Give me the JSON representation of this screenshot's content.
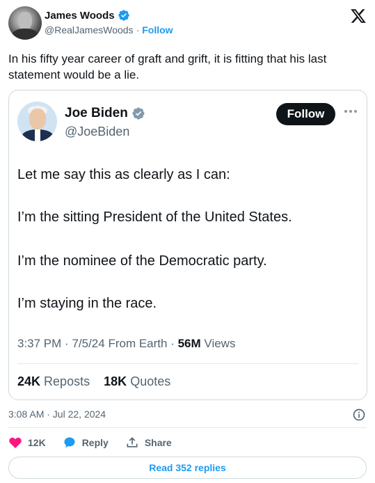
{
  "author": {
    "name": "James Woods",
    "handle": "@RealJamesWoods",
    "separator": "·",
    "follow_label": "Follow"
  },
  "tweet_text": "In his fifty year career of graft and grift, it is fitting that his last statement would be a lie.",
  "quoted": {
    "name": "Joe Biden",
    "handle": "@JoeBiden",
    "follow_label": "Follow",
    "lines": [
      "Let me say this as clearly as I can:",
      "I’m the sitting President of the United States.",
      "I’m the nominee of the Democratic party.",
      "I’m staying in the race."
    ],
    "time": "3:37 PM",
    "date": "7/5/24",
    "source": "From Earth",
    "views_count": "56M",
    "views_label": "Views",
    "reposts_count": "24K",
    "reposts_label": "Reposts",
    "quotes_count": "18K",
    "quotes_label": "Quotes"
  },
  "timestamp": "3:08 AM · Jul 22, 2024",
  "actions": {
    "like_count": "12K",
    "reply_label": "Reply",
    "share_label": "Share"
  },
  "read_replies_label": "Read 352 replies",
  "colors": {
    "accent": "#1d9bf0",
    "like": "#f91880",
    "text": "#0f1419",
    "muted": "#536471"
  },
  "icons": [
    "verified-badge-icon",
    "x-logo-icon",
    "more-icon",
    "info-icon",
    "heart-icon",
    "reply-bubble-icon",
    "share-icon"
  ]
}
